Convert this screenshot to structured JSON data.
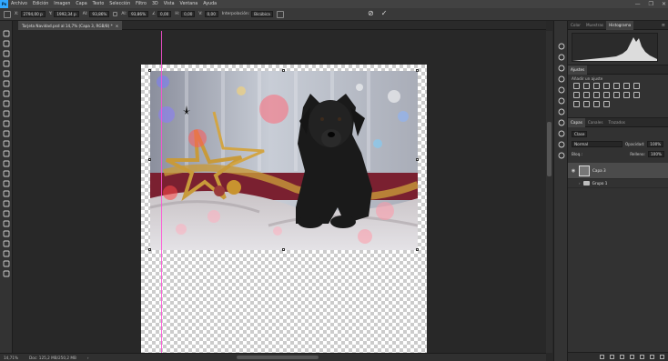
{
  "app": {
    "logo": "Ps"
  },
  "menu": [
    "Archivo",
    "Edición",
    "Imagen",
    "Capa",
    "Texto",
    "Selección",
    "Filtro",
    "3D",
    "Vista",
    "Ventana",
    "Ayuda"
  ],
  "window_controls": [
    "—",
    "❐",
    "✕"
  ],
  "options_bar": {
    "x_label": "X:",
    "x_value": "2794,00 p",
    "y_label": "Y:",
    "y_value": "1992,34 p",
    "w_label": "Al:",
    "w_value": "93,86%",
    "h_label": "Al:",
    "h_value": "93,86%",
    "angle_label": "∠",
    "angle_value": "0,00",
    "hskew_label": "H:",
    "hskew_value": "0,00",
    "vskew_label": "V:",
    "vskew_value": "0,00",
    "interp_label": "Interpolación:",
    "interp_value": "Bicúbica",
    "cancel_icon": "⊘",
    "commit_icon": "✓"
  },
  "document_tab": {
    "title": "Tarjeta Navidad.psd al 14,7% (Capa 3, RGB/8) *",
    "close": "×"
  },
  "status_bar": {
    "zoom": "14,71%",
    "doc_info": "Doc: 125,2 MB/250,2 MB",
    "arrow": "›"
  },
  "right_panels": {
    "top_tabs": [
      "Color",
      "Muestras",
      "Histograma"
    ],
    "top_active": "Histograma",
    "adjust_tabs": [
      "Ajustes"
    ],
    "adjust_hint": "Añadir un ajuste",
    "layer_tabs": [
      "Capas",
      "Canales",
      "Trazados"
    ],
    "layer_tab_active": "Capas",
    "kind_label": "Clase",
    "blend_mode": "Normal",
    "opacity_label": "Opacidad:",
    "opacity_value": "100%",
    "lock_label": "Bloq.:",
    "fill_label": "Relleno:",
    "fill_value": "100%",
    "layers": [
      {
        "name": "Capa 3",
        "type": "image",
        "selected": true
      },
      {
        "name": "Grupo 1",
        "type": "group",
        "selected": false
      }
    ]
  },
  "tools": [
    "move-tool",
    "artboard-tool",
    "marquee-tool",
    "lasso-tool",
    "quick-select-tool",
    "crop-tool",
    "frame-tool",
    "eyedropper-tool",
    "healing-brush-tool",
    "brush-tool",
    "clone-stamp-tool",
    "history-brush-tool",
    "eraser-tool",
    "gradient-tool",
    "blur-tool",
    "dodge-tool",
    "pen-tool",
    "type-tool",
    "path-select-tool",
    "rectangle-tool",
    "hand-tool",
    "zoom-tool",
    "more-tools",
    "color-swatches",
    "quick-mask"
  ],
  "strip_icons": [
    "play-icon",
    "info-icon",
    "properties-icon",
    "adjust-icon",
    "paragraph-icon",
    "character-icon",
    "libraries-icon",
    "brush-settings-icon",
    "navigator-icon",
    "actions-icon",
    "history-icon"
  ],
  "colors": {
    "guide": "#ff4fd6",
    "accent": "#31a8ff"
  }
}
